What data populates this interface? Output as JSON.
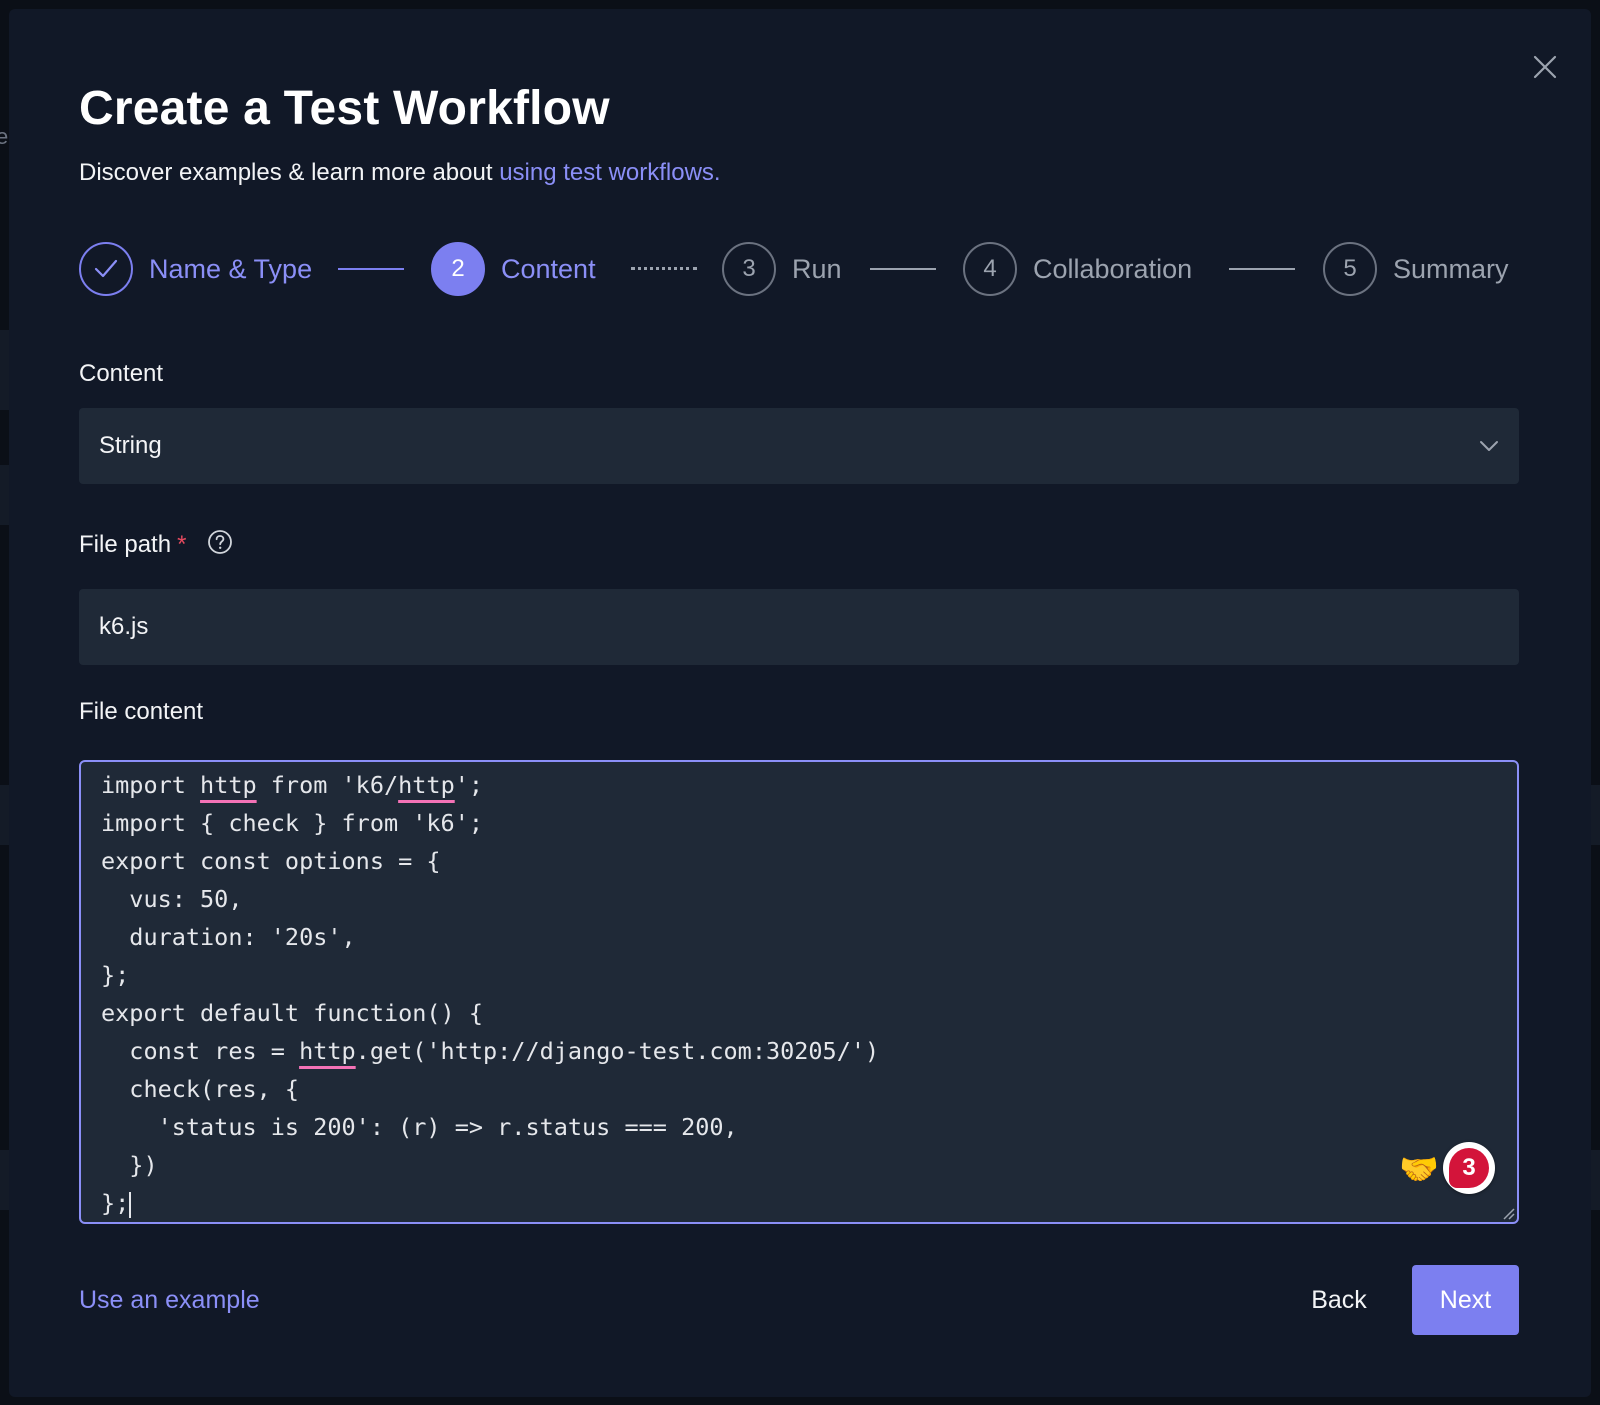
{
  "backdrop": {
    "partial_letter": "e"
  },
  "dialog": {
    "title": "Create a Test Workflow",
    "subtitle_text": "Discover examples & learn more about ",
    "subtitle_link": "using test workflows."
  },
  "stepper": {
    "steps": [
      {
        "number": "",
        "label": "Name & Type",
        "state": "completed",
        "icon": "check-icon"
      },
      {
        "number": "2",
        "label": "Content",
        "state": "active"
      },
      {
        "number": "3",
        "label": "Run",
        "state": "upcoming"
      },
      {
        "number": "4",
        "label": "Collaboration",
        "state": "upcoming"
      },
      {
        "number": "5",
        "label": "Summary",
        "state": "upcoming"
      }
    ]
  },
  "form": {
    "content_label": "Content",
    "content_type_value": "String",
    "file_path_label": "File path",
    "file_path_required": "*",
    "file_path_value": "k6.js",
    "file_content_label": "File content",
    "code_lines": [
      "import http from 'k6/http';",
      "import { check } from 'k6';",
      "export const options = {",
      "  vus: 50,",
      "  duration: '20s',",
      "};",
      "export default function() {",
      "  const res = http.get('http://django-test.com:30205/')",
      "  check(res, {",
      "    'status is 200': (r) => r.status === 200,",
      "  })",
      "};"
    ]
  },
  "extension": {
    "notification_count": "3"
  },
  "footer": {
    "example_link": "Use an example",
    "back_label": "Back",
    "next_label": "Next"
  },
  "colors": {
    "accent": "#7c7ff0",
    "link": "#8b8ff7",
    "background": "#111827",
    "field": "#1f2937",
    "required": "#e64a5f",
    "spellcheck_underline": "#f472b6"
  },
  "icons": [
    "close-icon",
    "check-icon",
    "chevron-down-icon",
    "help-circle-icon",
    "handshake-icon",
    "resize-handle-icon"
  ]
}
